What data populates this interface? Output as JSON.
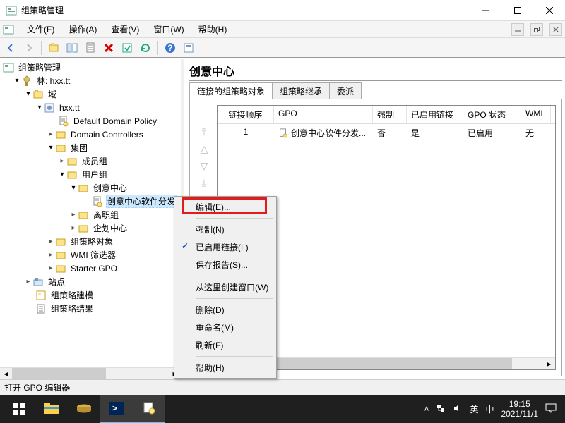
{
  "window": {
    "title": "组策略管理"
  },
  "menu": {
    "file": "文件(F)",
    "action": "操作(A)",
    "view": "查看(V)",
    "window": "窗口(W)",
    "help": "帮助(H)"
  },
  "tree": {
    "root": "组策略管理",
    "forest": "林: hxx.tt",
    "domains": "域",
    "domain": "hxx.tt",
    "default_policy": "Default Domain Policy",
    "domain_controllers": "Domain Controllers",
    "jituan": "集团",
    "chengyuan": "成员组",
    "yonghu": "用户组",
    "chuangyi": "创意中心",
    "chuangyi_gpo": "创意中心软件分发",
    "lizhi": "离职组",
    "qihua": "企划中心",
    "gpo_objects": "组策略对象",
    "wmi": "WMI 筛选器",
    "starter": "Starter GPO",
    "sites": "站点",
    "modeling": "组策略建模",
    "results": "组策略结果"
  },
  "detail": {
    "header": "创意中心",
    "tabs": {
      "linked": "链接的组策略对象",
      "inheritance": "组策略继承",
      "delegation": "委派"
    },
    "columns": {
      "order": "链接顺序",
      "gpo": "GPO",
      "enforced": "强制",
      "link_enabled": "已启用链接",
      "status": "GPO 状态",
      "wmi": "WMI"
    },
    "rows": [
      {
        "order": "1",
        "gpo": "创意中心软件分发...",
        "enforced": "否",
        "link_enabled": "是",
        "status": "已启用",
        "wmi": "无"
      }
    ]
  },
  "context": {
    "edit": "编辑(E)...",
    "enforce": "强制(N)",
    "link_enabled": "已启用链接(L)",
    "save_report": "保存报告(S)...",
    "new_window": "从这里创建窗口(W)",
    "delete": "删除(D)",
    "rename": "重命名(M)",
    "refresh": "刷新(F)",
    "help": "帮助(H)"
  },
  "status": {
    "text": "打开 GPO 编辑器"
  },
  "taskbar": {
    "ime1": "英",
    "ime2": "中",
    "time": "19:15",
    "date": "2021/11/1"
  }
}
